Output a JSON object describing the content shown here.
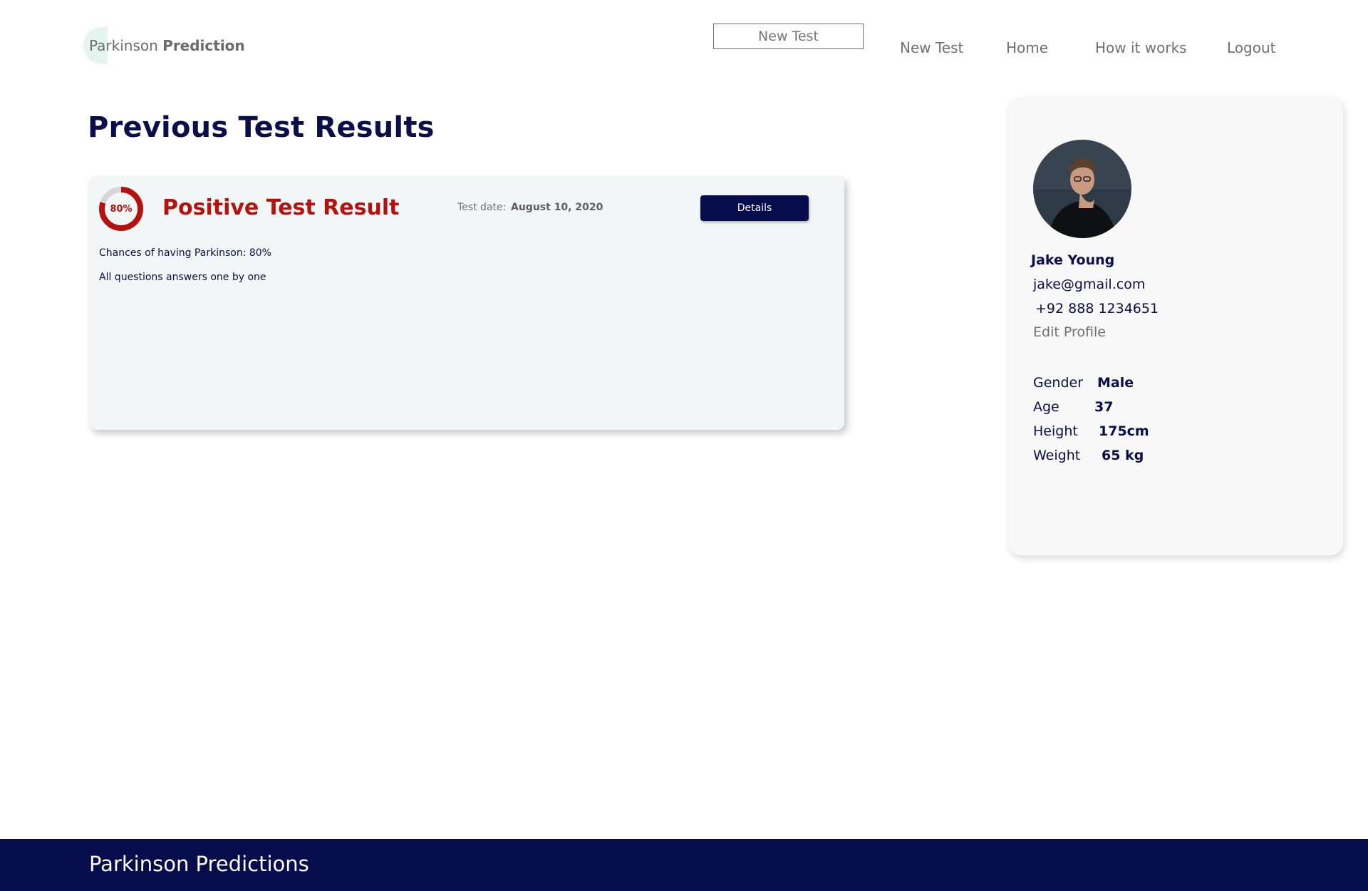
{
  "header": {
    "logo_light": "Parkinson",
    "logo_bold": "Prediction",
    "outline_button": "New Test",
    "nav": [
      "New Test",
      "Home",
      "How it works",
      "Logout"
    ]
  },
  "main": {
    "title": "Previous Test Results",
    "result": {
      "percent_label": "80%",
      "percent_value": 0.8,
      "title": "Positive Test Result",
      "date_label": "Test date:",
      "date_value": "August 10, 2020",
      "details_button": "Details",
      "chance_text": "Chances of having Parkinson: 80%",
      "answers_text": "All questions answers one by one"
    }
  },
  "profile": {
    "name": "Jake Young",
    "email": "jake@gmail.com",
    "phone": "+92 888 1234651",
    "edit": "Edit Profile",
    "stats": [
      {
        "label": "Gender",
        "value": "Male"
      },
      {
        "label": "Age",
        "value": "37"
      },
      {
        "label": "Height",
        "value": "175cm"
      },
      {
        "label": "Weight",
        "value": "65 kg"
      }
    ]
  },
  "footer": {
    "text": "Parkinson Predictions"
  },
  "colors": {
    "navy": "#060c4c",
    "red": "#b5120e",
    "card": "#f3f6f6"
  }
}
